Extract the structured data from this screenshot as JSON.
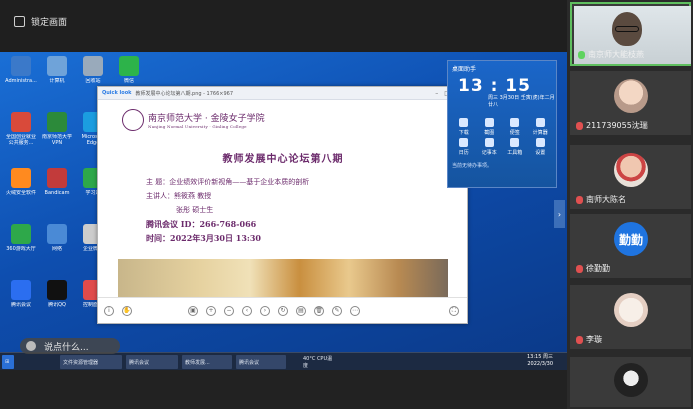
{
  "topbar": {
    "lock_label": "锁定画面"
  },
  "desktop": {
    "icons": [
      {
        "label": "Administra...",
        "color": "#3b79c9"
      },
      {
        "label": "全国创业就业公共服务...",
        "color": "#d94a3a"
      },
      {
        "label": "火绒安全软件",
        "color": "#ff8a1f"
      },
      {
        "label": "360游戏大厅",
        "color": "#2ea84a"
      },
      {
        "label": "腾讯会议",
        "color": "#2b6ef0"
      },
      {
        "label": "计算机",
        "color": "#6fa3d9"
      },
      {
        "label": "南京师范大学VPN",
        "color": "#2c8a3a"
      },
      {
        "label": "Bandicam",
        "color": "#c23b3b"
      },
      {
        "label": "网络",
        "color": "#4a8ad6"
      },
      {
        "label": "腾讯QQ",
        "color": "#111"
      },
      {
        "label": "回收站",
        "color": "#9ab"
      },
      {
        "label": "Microsoft Edge",
        "color": "#1b9de0"
      },
      {
        "label": "学习通",
        "color": "#2ea84a"
      },
      {
        "label": "企业微信",
        "color": "#ccc"
      },
      {
        "label": "控制面板",
        "color": "#e04b4b"
      },
      {
        "label": "微信",
        "color": "#2db34a"
      }
    ]
  },
  "speaking_bubble": "说点什么...",
  "viewer": {
    "app_name": "Quick look",
    "file_title": "教师发展中心论坛第八期.png - 1766×967",
    "slide": {
      "uni_cn": "南京师范大学 · 金陵女子学院",
      "uni_en": "Nanjing Normal University · Ginling College",
      "title": "教师发展中心论坛第八期",
      "topic": "主 题：企业绩效评价新视角——基于企业本质的剖析",
      "speaker1": "主讲人：熊筱燕  教授",
      "speaker2": "张彤  硕士生",
      "meeting": "腾讯会议  ID：266-768-066",
      "time": "时间：2022年3月30日 13:30"
    }
  },
  "widget": {
    "header": "桌面助手",
    "time": "13 : 15",
    "date": "周三 3月30日 壬寅(虎)年二月廿八",
    "items": [
      "下载",
      "截图",
      "便签",
      "计算器",
      "日历",
      "记事本",
      "工具箱",
      "设置"
    ],
    "footer": "当前无待办事项。"
  },
  "taskbar": {
    "items": [
      "腾讯会议",
      "文件资源管理器",
      "教师发展...",
      "腾讯会议"
    ],
    "temp": "40°C CPU温度",
    "clock": "13:15 周三",
    "date": "2022/3/30"
  },
  "participants": [
    {
      "name": "南京师大能枝燕",
      "type": "video",
      "mic": "on"
    },
    {
      "name": "211739055沈瑞",
      "type": "photo",
      "mic": "off"
    },
    {
      "name": "南师大陈名",
      "type": "photo",
      "mic": "off"
    },
    {
      "name": "徐勤勤",
      "type": "initial",
      "initial": "勤勤",
      "mic": "off"
    },
    {
      "name": "李璇",
      "type": "photo",
      "mic": "off"
    },
    {
      "name": "",
      "type": "photo",
      "mic": "off"
    }
  ]
}
